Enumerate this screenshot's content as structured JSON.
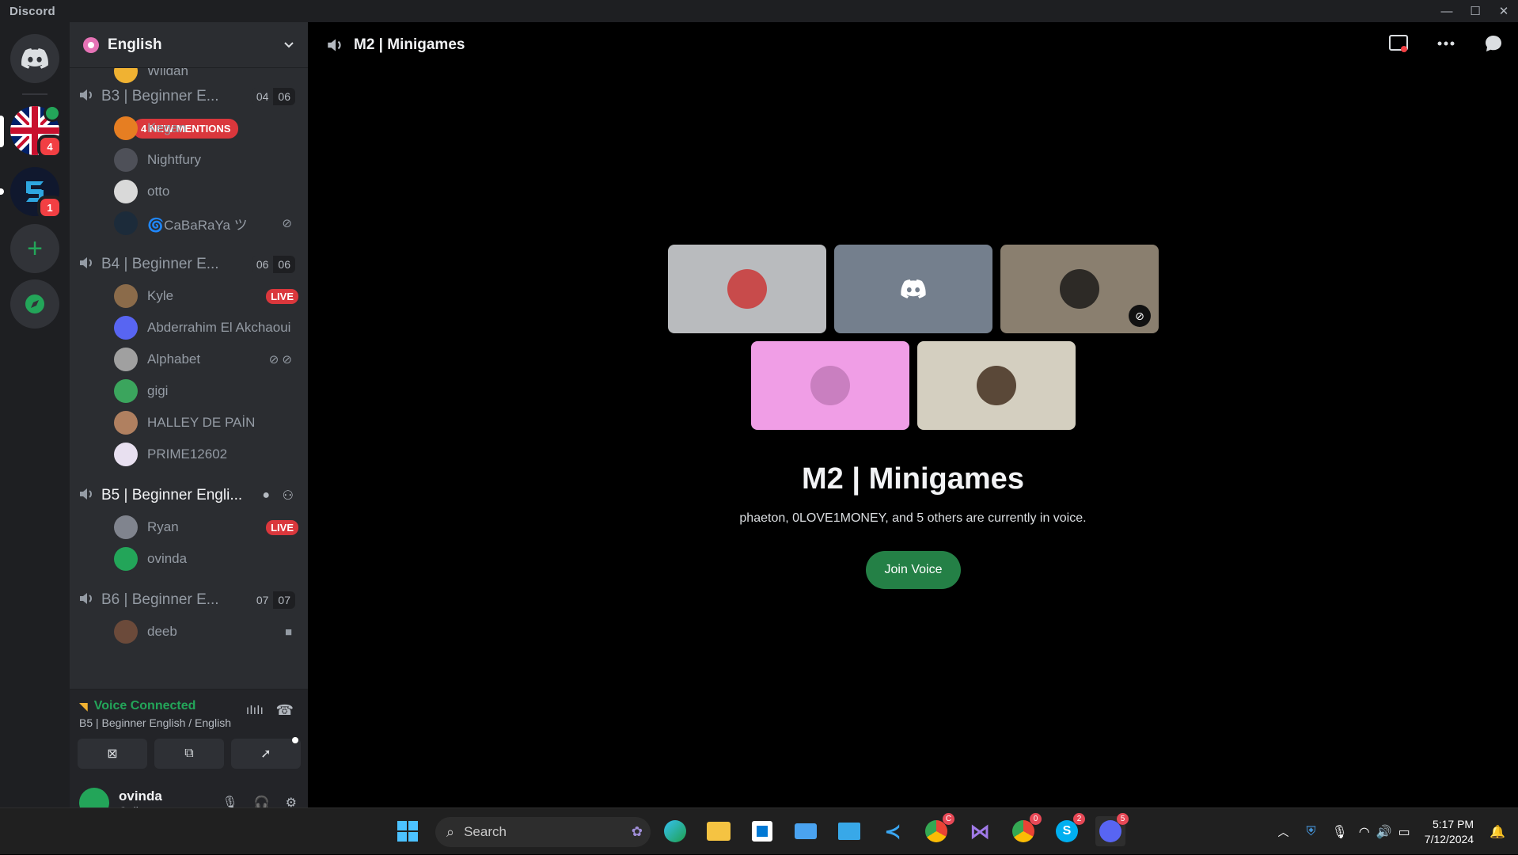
{
  "window": {
    "app_title": "Discord",
    "minimize": "—",
    "maximize": "☐",
    "close": "✕"
  },
  "servers": [
    {
      "name": "English",
      "badge": "4"
    },
    {
      "name": "S server",
      "badge": "1"
    }
  ],
  "guild": {
    "name": "English"
  },
  "sidebar": {
    "mentions_pill": "4 NEW MENTIONS",
    "prev_user": "Wildan",
    "channels": [
      {
        "label": "B3 | Beginner E...",
        "count_a": "04",
        "count_b": "06",
        "users": [
          "Kegan",
          "Nightfury",
          "otto",
          "🌀CaBaRaYa ツ"
        ]
      },
      {
        "label": "B4 | Beginner E...",
        "count_a": "06",
        "count_b": "06",
        "users": [
          "Kyle",
          "Abderrahim El Akchaoui",
          "Alphabet",
          "gigi",
          "HALLEY DE PAİN",
          "PRIME12602"
        ]
      },
      {
        "label": "B5 | Beginner Engli...",
        "users": [
          "Ryan",
          "ovinda"
        ]
      },
      {
        "label": "B6 | Beginner E...",
        "count_a": "07",
        "count_b": "07",
        "users": [
          "deeb"
        ]
      }
    ],
    "live_label": "LIVE"
  },
  "voice": {
    "status": "Voice Connected",
    "channel": "B5 | Beginner English / English"
  },
  "user": {
    "name": "ovinda",
    "status": "Online"
  },
  "main": {
    "channel_title": "M2 | Minigames",
    "big_title": "M2 | Minigames",
    "description": "phaeton, 0LOVE1MONEY, and 5 others are currently in voice.",
    "join_label": "Join Voice"
  },
  "taskbar": {
    "search_placeholder": "Search",
    "time": "5:17 PM",
    "date": "7/12/2024",
    "badges": {
      "chrome1": "C",
      "chrome2": "0",
      "skype": "2",
      "discord": "5"
    }
  },
  "colors": {
    "accent_green": "#248046",
    "danger": "#da373c",
    "sidebar": "#2b2d31",
    "rail": "#1e1f22"
  }
}
